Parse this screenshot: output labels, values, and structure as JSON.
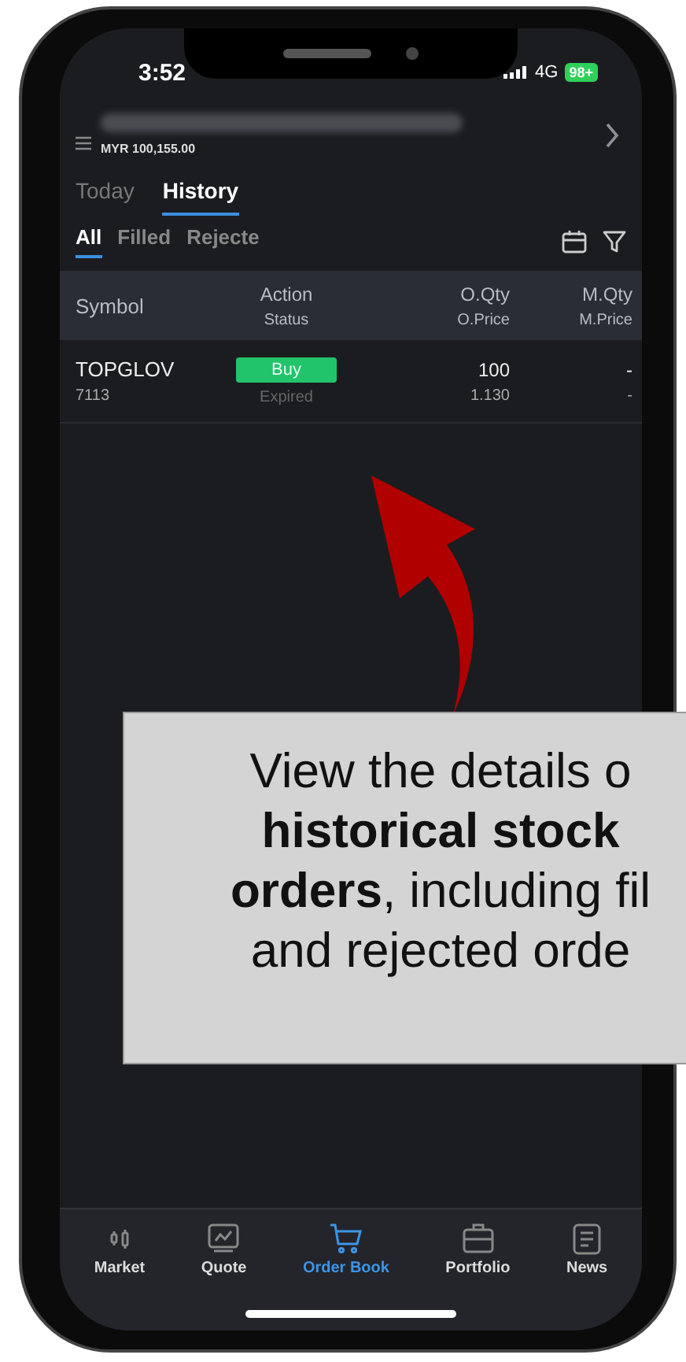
{
  "status_bar": {
    "time": "3:52",
    "network": "4G",
    "battery": "98+"
  },
  "account": {
    "balance": "MYR 100,155.00"
  },
  "tabs": [
    {
      "label": "Today",
      "selected": false
    },
    {
      "label": "History",
      "selected": true
    }
  ],
  "filters": [
    {
      "label": "All",
      "selected": true
    },
    {
      "label": "Filled",
      "selected": false
    },
    {
      "label": "Rejecte",
      "selected": false
    }
  ],
  "table": {
    "columns": [
      {
        "top": "Symbol"
      },
      {
        "top": "Action",
        "bottom": "Status"
      },
      {
        "top": "O.Qty",
        "bottom": "O.Price"
      },
      {
        "top": "M.Qty",
        "bottom": "M.Price"
      }
    ],
    "rows": [
      {
        "symbol": "TOPGLOV",
        "code": "7113",
        "action": "Buy",
        "status": "Expired",
        "o_qty": "100",
        "o_price": "1.130",
        "m_qty": "-",
        "m_price": "-"
      }
    ]
  },
  "bottom_nav": [
    {
      "label": "Market",
      "kind": "candles",
      "selected": false
    },
    {
      "label": "Quote",
      "kind": "chart",
      "selected": false
    },
    {
      "label": "Order Book",
      "kind": "cart",
      "selected": true
    },
    {
      "label": "Portfolio",
      "kind": "briefcase",
      "selected": false
    },
    {
      "label": "News",
      "kind": "doc",
      "selected": false
    }
  ],
  "callout": {
    "lines": [
      "View the details o",
      "**historical stock**",
      "**orders**, including fil",
      "and rejected orde"
    ]
  }
}
